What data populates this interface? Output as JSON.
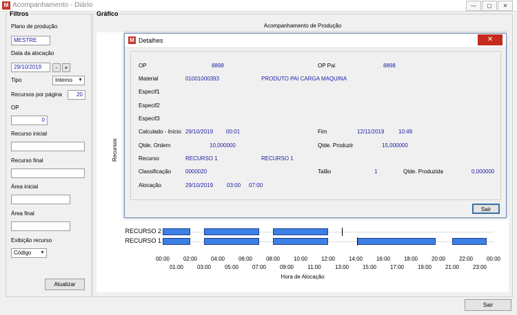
{
  "window": {
    "title": "Acompanhamento - Diário",
    "icon_letter": "M",
    "accent": "#c0392b",
    "controls": [
      "—",
      "▢",
      "✕"
    ]
  },
  "filters": {
    "title": "Filtros",
    "plano_label": "Plano de produção",
    "plano_value": "MESTRE",
    "data_label": "Data da alocação",
    "data_value": "29/10/2019",
    "minus_label": "-",
    "plus_label": "+",
    "tipo_label": "Tipo",
    "tipo_value": "Interno",
    "recursos_label": "Recursos por página",
    "recursos_value": "20",
    "op_label": "OP",
    "op_value": "0",
    "recurso_inicial_label": "Recurso inicial",
    "recurso_inicial_value": "",
    "recurso_final_label": "Recurso final",
    "recurso_final_value": "",
    "area_inicial_label": "Área inicial",
    "area_inicial_value": "",
    "area_final_label": "Área final",
    "area_final_value": "",
    "exibicao_label": "Exibição recurso",
    "exibicao_value": "Código",
    "atualizar_label": "Atualizar"
  },
  "chart_panel": {
    "title": "Gráfico",
    "sair_label": "Sair"
  },
  "chart_data": {
    "type": "gantt",
    "title": "Acompanhamento de Produção",
    "xlabel": "Hora de Alocação",
    "ylabel": "Recursos",
    "categories": [
      "RECURSO 2",
      "RECURSO 1"
    ],
    "x_ticks_top": [
      "00:00",
      "02:00",
      "04:00",
      "06:00",
      "08:00",
      "10:00",
      "12:00",
      "14:00",
      "16:00",
      "18:00",
      "20:00",
      "22:00",
      "00:00"
    ],
    "x_ticks_bottom": [
      "01:00",
      "03:00",
      "05:00",
      "07:00",
      "09:00",
      "11:00",
      "13:00",
      "15:00",
      "17:00",
      "19:00",
      "21:00",
      "23:00"
    ],
    "xlim": [
      0,
      24
    ],
    "bar_color": "#3c80e6",
    "series": [
      {
        "resource": "RECURSO 2",
        "intervals": [
          [
            0.0,
            2.0
          ],
          [
            3.0,
            7.0
          ],
          [
            8.0,
            12.0
          ]
        ],
        "markers": [
          13.0
        ]
      },
      {
        "resource": "RECURSO 1",
        "intervals": [
          [
            0.0,
            2.0
          ],
          [
            3.0,
            7.0
          ],
          [
            8.0,
            12.0
          ],
          [
            14.1,
            19.8
          ],
          [
            21.0,
            23.5
          ]
        ],
        "markers": [
          14.1
        ]
      }
    ]
  },
  "dialog": {
    "title": "Detalhes",
    "op_label": "OP",
    "op_value": "8898",
    "op_pai_label": "OP Pai",
    "op_pai_value": "8898",
    "material_label": "Material",
    "material_code": "01001000393",
    "material_desc": "PRODUTO PAI CARGA MAQUINA",
    "especif1_label": "Especif1",
    "especif2_label": "Especif2",
    "especif3_label": "Especif3",
    "calculado_label": "Calculado - Início",
    "calculado_date": "29/10/2019",
    "calculado_time": "00:01",
    "fim_label": "Fim",
    "fim_date": "12/11/2019",
    "fim_time": "10:49",
    "qtde_ordem_label": "Qtde. Ordem",
    "qtde_ordem_value": "10,000000",
    "qtde_produzir_label": "Qtde. Produzir",
    "qtde_produzir_value": "15,000000",
    "recurso_label": "Recurso",
    "recurso_value1": "RECURSO 1",
    "recurso_value2": "RECURSO 1",
    "classificacao_label": "Classificação",
    "classificacao_value": "0000020",
    "talao_label": "Talão",
    "talao_value": "1",
    "qtde_produzida_label": "Qtde. Produzida",
    "qtde_produzida_value": "0,000000",
    "alocacao_label": "Alocação",
    "alocacao_date": "29/10/2019",
    "alocacao_start": "03:00",
    "alocacao_end": "07:00",
    "sair_label": "Sair"
  }
}
